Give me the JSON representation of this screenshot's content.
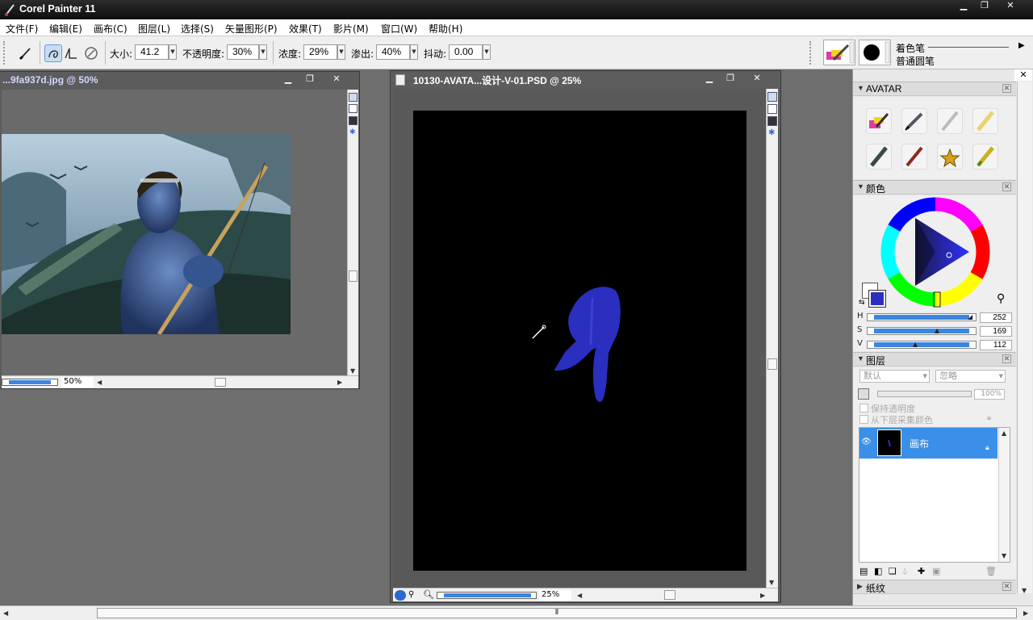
{
  "app": {
    "title": "Corel Painter 11"
  },
  "menu": [
    "文件(F)",
    "编辑(E)",
    "画布(C)",
    "图层(L)",
    "选择(S)",
    "矢量图形(P)",
    "效果(T)",
    "影片(M)",
    "窗口(W)",
    "帮助(H)"
  ],
  "toolbar": {
    "size_label": "大小:",
    "size_value": "41.2",
    "opacity_label": "不透明度:",
    "opacity_value": "30%",
    "grain_label": "浓度:",
    "grain_value": "29%",
    "bleed_label": "渗出:",
    "bleed_value": "40%",
    "jitter_label": "抖动:",
    "jitter_value": "0.00",
    "brush_category": "着色笔",
    "brush_variant": "普通圆笔"
  },
  "windows": {
    "ref": {
      "title": "...9fa937d.jpg @ 50%",
      "zoom": "50%"
    },
    "main": {
      "title": "10130-AVATA...设计-V-01.PSD @ 25%",
      "zoom": "25%"
    }
  },
  "panels": {
    "avatar": {
      "title": "AVATAR"
    },
    "color": {
      "title": "颜色",
      "h_label": "H",
      "h_value": "252",
      "s_label": "S",
      "s_value": "169",
      "v_label": "V",
      "v_value": "112",
      "h_fraction": 0.97,
      "s_fraction": 0.66,
      "v_fraction": 0.44,
      "current_color": "#2a2fc0",
      "secondary_color": "#ffffff"
    },
    "layers": {
      "title": "图层",
      "composite_method": "默认",
      "composite_depth": "忽略",
      "opacity": "100%",
      "preserve_transparency": "保持透明度",
      "pick_up_color": "从下层采集颜色",
      "layer_name": "画布"
    },
    "paper": {
      "title": "纸纹"
    }
  },
  "colors": {
    "accent": "#3b86e0",
    "stroke": "#2a2fc0",
    "canvas": "#000000"
  }
}
